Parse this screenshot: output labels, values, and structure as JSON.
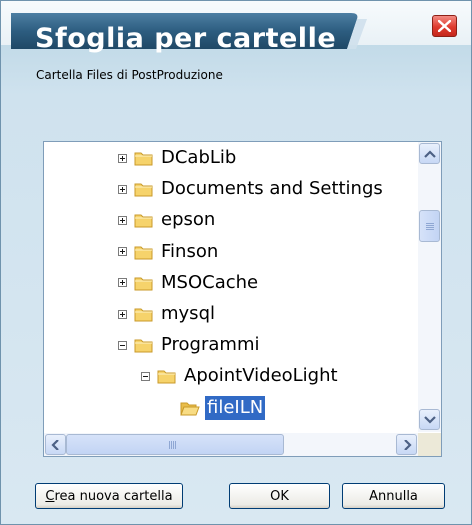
{
  "window": {
    "title": "Sfoglia per cartelle",
    "close_icon": "close-icon"
  },
  "description": "Cartella Files di PostProduzione",
  "tree": {
    "items": [
      {
        "label": "DCabLib",
        "expander": "plus",
        "level": 0
      },
      {
        "label": "Documents and Settings",
        "expander": "plus",
        "level": 0
      },
      {
        "label": "epson",
        "expander": "plus",
        "level": 0
      },
      {
        "label": "Finson",
        "expander": "plus",
        "level": 0
      },
      {
        "label": "MSOCache",
        "expander": "plus",
        "level": 0
      },
      {
        "label": "mysql",
        "expander": "plus",
        "level": 0
      },
      {
        "label": "Programmi",
        "expander": "minus",
        "level": 0
      },
      {
        "label": "ApointVideoLight",
        "expander": "minus",
        "level": 1
      },
      {
        "label": "fileILN",
        "expander": "none",
        "level": 2,
        "selected": true,
        "icon": "open-folder-icon"
      }
    ]
  },
  "buttons": {
    "new_folder_first": "C",
    "new_folder_rest": "rea nuova cartella",
    "ok": "OK",
    "cancel": "Annulla"
  },
  "colors": {
    "selection": "#316ac5",
    "title_tab": "#2d5d80",
    "close": "#de3b2f"
  }
}
